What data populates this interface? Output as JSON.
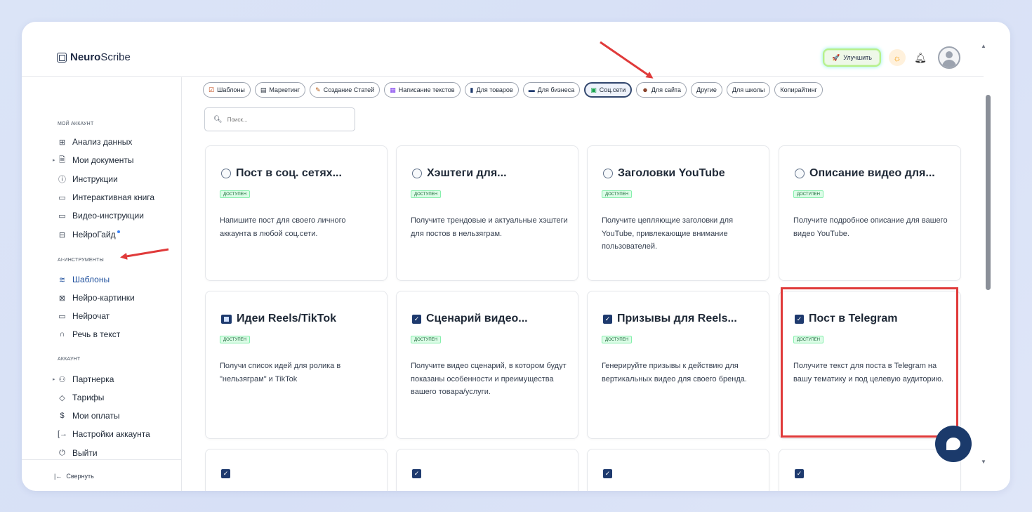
{
  "app": {
    "logo_bold": "Neuro",
    "logo_light": "Scribe",
    "upgrade_label": "Улучшить"
  },
  "sidebar": {
    "section_account": "МОЙ АККАУНТ",
    "account_items": [
      {
        "label": "Анализ данных",
        "icon": "grid-icon"
      },
      {
        "label": "Мои документы",
        "icon": "document-icon"
      },
      {
        "label": "Инструкции",
        "icon": "help-circle-icon"
      },
      {
        "label": "Интерактивная книга",
        "icon": "book-icon"
      },
      {
        "label": "Видео-инструкции",
        "icon": "video-icon"
      },
      {
        "label": "НейроГайд",
        "icon": "layout-icon"
      }
    ],
    "section_ai": "AI-ИНСТРУМЕНТЫ",
    "ai_items": [
      {
        "label": "Шаблоны",
        "icon": "layers-icon",
        "active": true
      },
      {
        "label": "Нейро-картинки",
        "icon": "image-icon"
      },
      {
        "label": "Нейрочат",
        "icon": "chat-icon"
      },
      {
        "label": "Речь в текст",
        "icon": "headphones-icon"
      }
    ],
    "section_acc": "АККАУНТ",
    "acc_items": [
      {
        "label": "Партнерка",
        "icon": "users-icon"
      },
      {
        "label": "Тарифы",
        "icon": "tag-icon"
      },
      {
        "label": "Мои оплаты",
        "icon": "dollar-icon"
      },
      {
        "label": "Настройки аккаунта",
        "icon": "login-icon"
      },
      {
        "label": "Выйти",
        "icon": "power-icon"
      }
    ],
    "collapse_label": "Свернуть"
  },
  "chips": [
    {
      "label": "Шаблоны",
      "icon": "☑"
    },
    {
      "label": "Маркетинг",
      "icon": "▤"
    },
    {
      "label": "Создание Статей",
      "icon": "✎"
    },
    {
      "label": "Написание текстов",
      "icon": "▦"
    },
    {
      "label": "Для товаров",
      "icon": "▮"
    },
    {
      "label": "Для бизнеса",
      "icon": "▬"
    },
    {
      "label": "Соц.сети",
      "icon": "▣",
      "active": true
    },
    {
      "label": "Для сайта",
      "icon": "☻"
    },
    {
      "label": "Другие",
      "icon": ""
    },
    {
      "label": "Для школы",
      "icon": ""
    },
    {
      "label": "Копирайтинг",
      "icon": ""
    }
  ],
  "search": {
    "placeholder": "Поиск..."
  },
  "cards": [
    {
      "title": "Пост в соц. сетях...",
      "badge": "ДОСТУПЕН",
      "desc": "Напишите пост для своего личного аккаунта в любой соц.сети.",
      "icon": "circle"
    },
    {
      "title": "Хэштеги для...",
      "badge": "ДОСТУПЕН",
      "desc": "Получите трендовые и актуальные хэштеги для постов в нельзяграм.",
      "icon": "circle"
    },
    {
      "title": "Заголовки YouTube",
      "badge": "ДОСТУПЕН",
      "desc": "Получите цепляющие заголовки для YouTube, привлекающие внимание пользователей.",
      "icon": "circle"
    },
    {
      "title": "Описание видео для...",
      "badge": "ДОСТУПЕН",
      "desc": "Получите подробное описание для вашего видео YouTube.",
      "icon": "circle"
    },
    {
      "title": "Идеи Reels/TikTok",
      "badge": "ДОСТУПЕН",
      "desc": "Получи список идей для ролика в \"нельзяграм\" и TikTok",
      "icon": "film"
    },
    {
      "title": "Сценарий видео...",
      "badge": "ДОСТУПЕН",
      "desc": "Получите видео сценарий, в котором будут показаны особенности и преимущества вашего товара/услуги.",
      "icon": "check"
    },
    {
      "title": "Призывы для Reels...",
      "badge": "ДОСТУПЕН",
      "desc": "Генерируйте призывы к действию для вертикальных видео для своего бренда.",
      "icon": "check"
    },
    {
      "title": "Пост в Telegram",
      "badge": "ДОСТУПЕН",
      "desc": "Получите текст для поста в Telegram на вашу тематику и под целевую аудиторию.",
      "icon": "check"
    }
  ],
  "colors": {
    "accent": "#1e3a6e",
    "annotation_red": "#e03a3a",
    "badge_green": "#dcfce7"
  }
}
